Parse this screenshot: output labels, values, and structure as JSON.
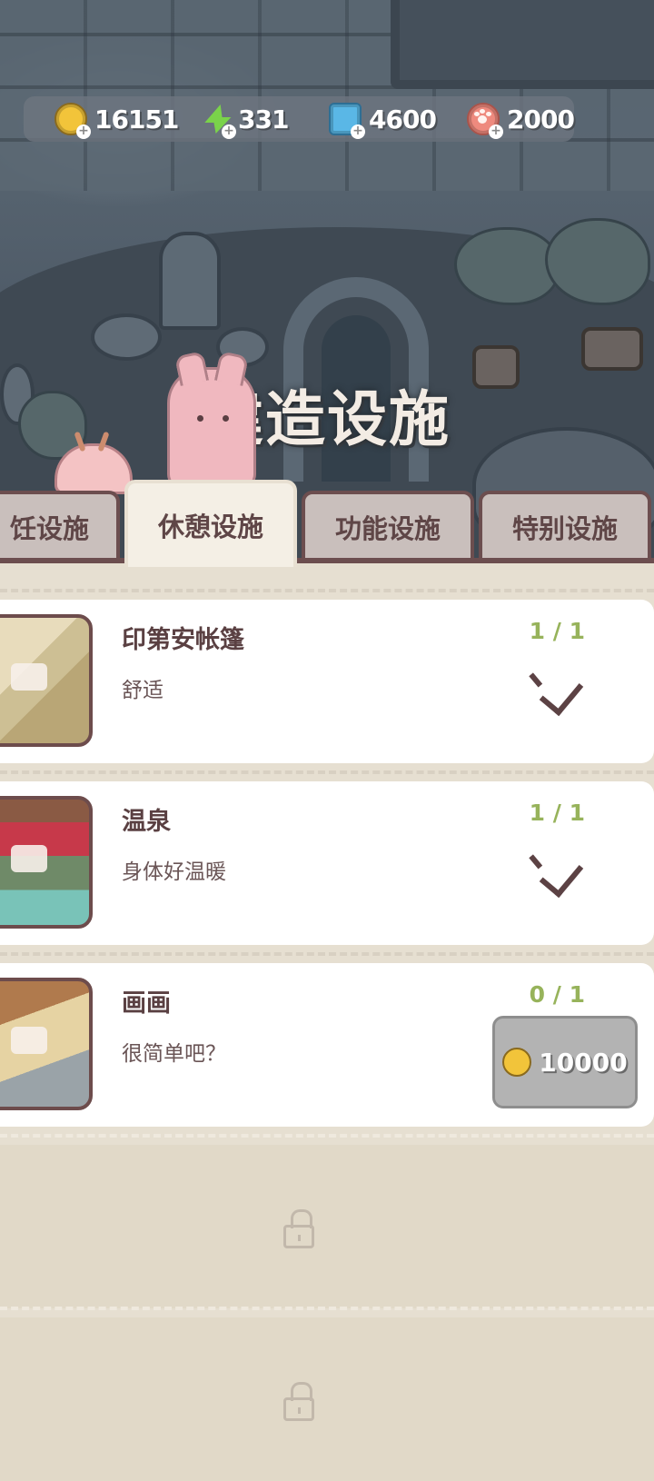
{
  "currency": {
    "coins": "16151",
    "energy": "331",
    "gems": "4600",
    "paws": "2000"
  },
  "page_title": "建造设施",
  "tabs": [
    {
      "label": "烹饪设施",
      "visible": "饪设施"
    },
    {
      "label": "休憩设施"
    },
    {
      "label": "功能设施"
    },
    {
      "label": "特别设施"
    }
  ],
  "items": [
    {
      "name": "印第安帐篷",
      "desc": "舒适",
      "count": "1 / 1",
      "status": "owned"
    },
    {
      "name": "温泉",
      "desc": "身体好温暖",
      "count": "1 / 1",
      "status": "owned"
    },
    {
      "name": "画画",
      "desc": "很简单吧？",
      "count": "0 / 1",
      "status": "buy",
      "price": "10000"
    }
  ],
  "colors": {
    "count_green": "#97b35b",
    "tab_border": "#6c4e4f",
    "coin": "#f2c43a"
  }
}
